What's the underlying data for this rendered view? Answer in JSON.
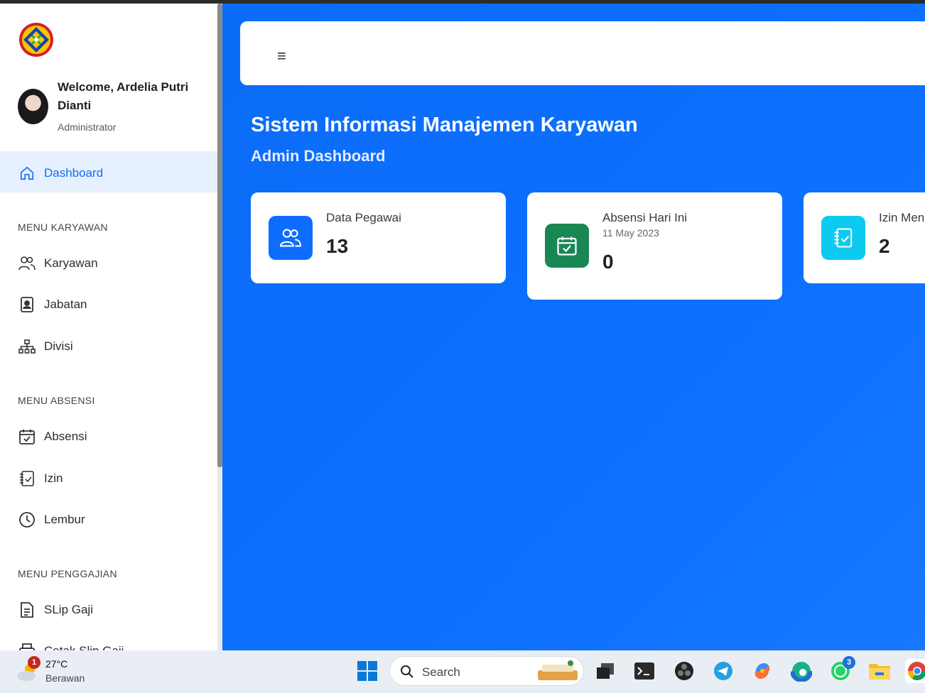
{
  "sidebar": {
    "welcome": "Welcome, Ardelia Putri Dianti",
    "role": "Administrator",
    "dashboard_label": "Dashboard",
    "section_karyawan": "MENU KARYAWAN",
    "karyawan": "Karyawan",
    "jabatan": "Jabatan",
    "divisi": "Divisi",
    "section_absensi": "MENU ABSENSI",
    "absensi": "Absensi",
    "izin": "Izin",
    "lembur": "Lembur",
    "section_penggajian": "MENU PENGGAJIAN",
    "slip_gaji": "SLip Gaji",
    "cetak_slip": "Cetak Slip Gaji"
  },
  "header": {
    "menu_icon": "≡",
    "title": "Sistem Informasi Manajemen Karyawan",
    "subtitle": "Admin Dashboard"
  },
  "cards": {
    "pegawai": {
      "label": "Data Pegawai",
      "value": "13",
      "color": "#0d6efd"
    },
    "absensi": {
      "label": "Absensi Hari Ini",
      "date": "11 May 2023",
      "value": "0",
      "color": "#198754"
    },
    "izin": {
      "label": "Izin Menunggu",
      "value": "2",
      "color": "#0dcaf0"
    }
  },
  "taskbar": {
    "temp": "27°C",
    "weather": "Berawan",
    "weather_badge": "1",
    "search": "Search",
    "whatsapp_badge": "3"
  }
}
